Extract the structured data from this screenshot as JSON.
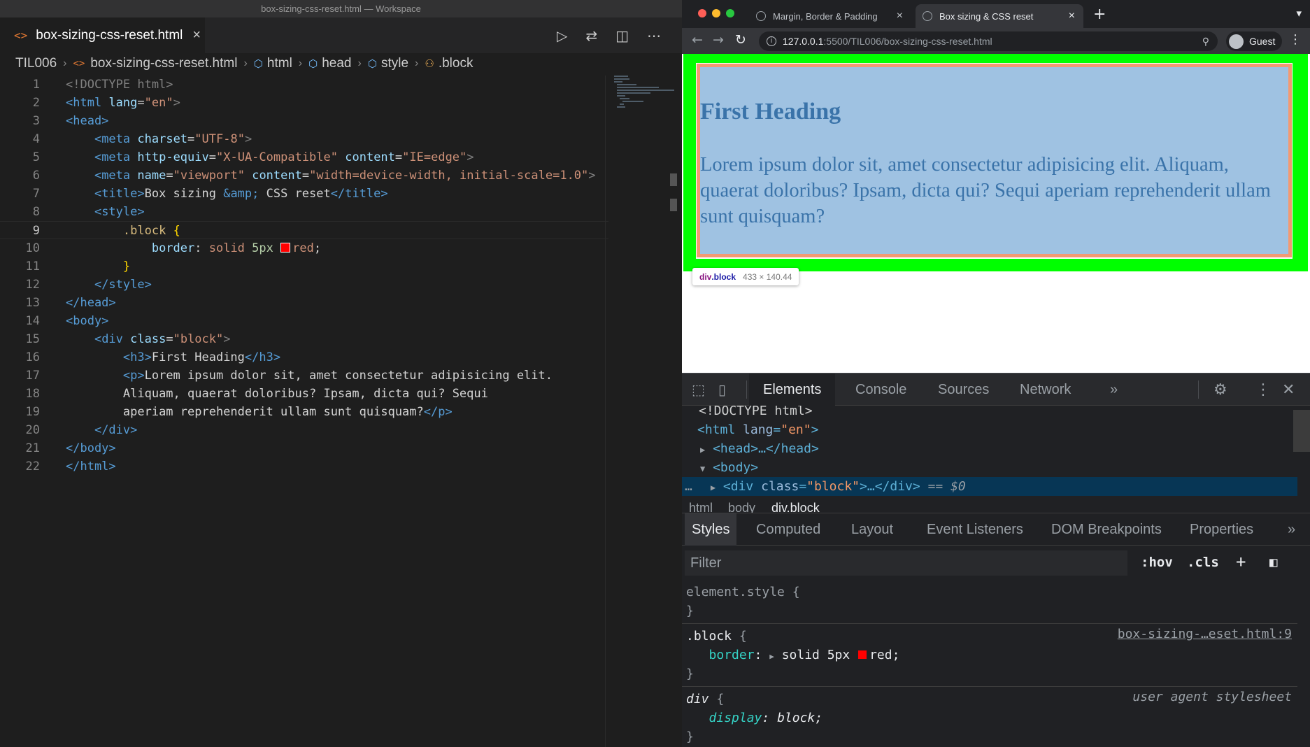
{
  "window": {
    "title": "box-sizing-css-reset.html — Workspace"
  },
  "editor": {
    "tab": {
      "label": "box-sizing-css-reset.html",
      "close": "×"
    },
    "breadcrumb": [
      "TIL006",
      "box-sizing-css-reset.html",
      "html",
      "head",
      "style",
      ".block"
    ],
    "lines": [
      {
        "n": "1"
      },
      {
        "n": "2"
      },
      {
        "n": "3"
      },
      {
        "n": "4"
      },
      {
        "n": "5"
      },
      {
        "n": "6"
      },
      {
        "n": "7"
      },
      {
        "n": "8"
      },
      {
        "n": "9"
      },
      {
        "n": "10"
      },
      {
        "n": "11"
      },
      {
        "n": "12"
      },
      {
        "n": "13"
      },
      {
        "n": "14"
      },
      {
        "n": "15"
      },
      {
        "n": "16"
      },
      {
        "n": "17"
      },
      {
        "n": "18"
      },
      {
        "n": "19"
      },
      {
        "n": "20"
      },
      {
        "n": "21"
      },
      {
        "n": "22"
      }
    ],
    "code": {
      "l1": "<!DOCTYPE html>",
      "l2_tag": "<html",
      "l2_attr": "lang",
      "l2_val": "\"en\"",
      "l2_end": ">",
      "l3": "<head>",
      "l4_tag": "<meta",
      "l4_attr": "charset",
      "l4_val": "\"UTF-8\"",
      "l4_end": ">",
      "l5_tag": "<meta",
      "l5_attr1": "http-equiv",
      "l5_val1": "\"X-UA-Compatible\"",
      "l5_attr2": "content",
      "l5_val2": "\"IE=edge\"",
      "l5_end": ">",
      "l6_tag": "<meta",
      "l6_attr1": "name",
      "l6_val1": "\"viewport\"",
      "l6_attr2": "content",
      "l6_val2": "\"width=device-width, initial-scale=1.0\"",
      "l6_end": ">",
      "l7_open": "<title>",
      "l7_text1": "Box sizing ",
      "l7_ent": "&amp;",
      "l7_text2": " CSS reset",
      "l7_close": "</title>",
      "l8": "<style>",
      "l9_sel": ".block",
      "l9_brace": "{",
      "l10_prop": "border",
      "l10_val1": "solid ",
      "l10_num": "5px",
      "l10_color": "red",
      "l10_end": ";",
      "l11": "}",
      "l12": "</style>",
      "l13": "</head>",
      "l14": "<body>",
      "l15_tag": "<div",
      "l15_attr": "class",
      "l15_val": "\"block\"",
      "l15_end": ">",
      "l16_open": "<h3>",
      "l16_text": "First Heading",
      "l16_close": "</h3>",
      "l17_open": "<p>",
      "l17_text": "Lorem ipsum dolor sit, amet consectetur adipisicing elit.",
      "l18": "Aliquam, quaerat doloribus? Ipsam, dicta qui? Sequi",
      "l19_text": "aperiam reprehenderit ullam sunt quisquam?",
      "l19_close": "</p>",
      "l20": "</div>",
      "l21": "</body>",
      "l22": "</html>"
    }
  },
  "browser": {
    "tabs": [
      {
        "label": "Margin, Border & Padding",
        "close": "×"
      },
      {
        "label": "Box sizing & CSS reset",
        "close": "×"
      }
    ],
    "new_tab": "+",
    "url_host": "127.0.0.1",
    "url_path": ":5500/TIL006/box-sizing-css-reset.html",
    "profile": "Guest",
    "page": {
      "heading": "First Heading",
      "paragraph": "Lorem ipsum dolor sit, amet consectetur adipisicing elit. Aliquam, quaerat doloribus? Ipsam, dicta qui? Sequi aperiam reprehenderit ullam sunt quisquam?"
    },
    "tooltip": {
      "tag": "div",
      "cls": ".block",
      "dims": "433 × 140.44"
    }
  },
  "devtools": {
    "tabs": [
      "Elements",
      "Console",
      "Sources",
      "Network"
    ],
    "more": "»",
    "dom": {
      "doctype": "<!DOCTYPE html>",
      "html_open": "<html",
      "html_attr": "lang",
      "html_val": "\"en\"",
      "head": "<head>…</head>",
      "body": "<body>",
      "div_open": "<div",
      "div_attr": "class",
      "div_val": "\"block\"",
      "div_rest": ">…</div>",
      "div_eq": "== $0",
      "dots": "…"
    },
    "crumbs": [
      "html",
      "body",
      "div.block"
    ],
    "subtabs": [
      "Styles",
      "Computed",
      "Layout",
      "Event Listeners",
      "DOM Breakpoints",
      "Properties"
    ],
    "filter_placeholder": "Filter",
    "hov": ":hov",
    "cls": ".cls",
    "styles": {
      "element_style": "element.style {",
      "close": "}",
      "block_sel": ".block",
      "block_open": " {",
      "block_src": "box-sizing-…eset.html:9",
      "block_prop": "border",
      "block_val1": "solid 5px",
      "block_color": "red",
      "div_sel": "div",
      "div_src": "user agent stylesheet",
      "div_prop": "display",
      "div_val": "block;"
    }
  },
  "colors": {
    "margin_highlight": "#00ff00",
    "border_highlight": "#f29a73",
    "content_highlight": "#9fc2e2",
    "swatch": "#ff0000"
  }
}
